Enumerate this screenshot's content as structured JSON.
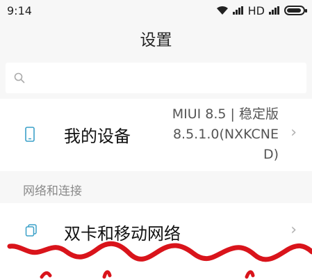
{
  "status_bar": {
    "time": "9:14",
    "network_type": "HD",
    "battery_level": 0.9
  },
  "page": {
    "title": "设置"
  },
  "search": {
    "placeholder": "",
    "icon": "search-icon"
  },
  "device": {
    "label": "我的设备",
    "version_line1": "MIUI 8.5 | 稳定版",
    "version_line2": "8.5.1.0(NXKCNE",
    "version_line3": "D)",
    "icon": "phone-icon"
  },
  "network_section": {
    "header": "网络和连接",
    "items": [
      {
        "label": "双卡和移动网络",
        "icon": "sim-card-icon"
      }
    ]
  },
  "colors": {
    "background": "#f7f7f7",
    "card": "#ffffff",
    "accent": "#3aa0c8",
    "annotation": "#d9141b"
  }
}
